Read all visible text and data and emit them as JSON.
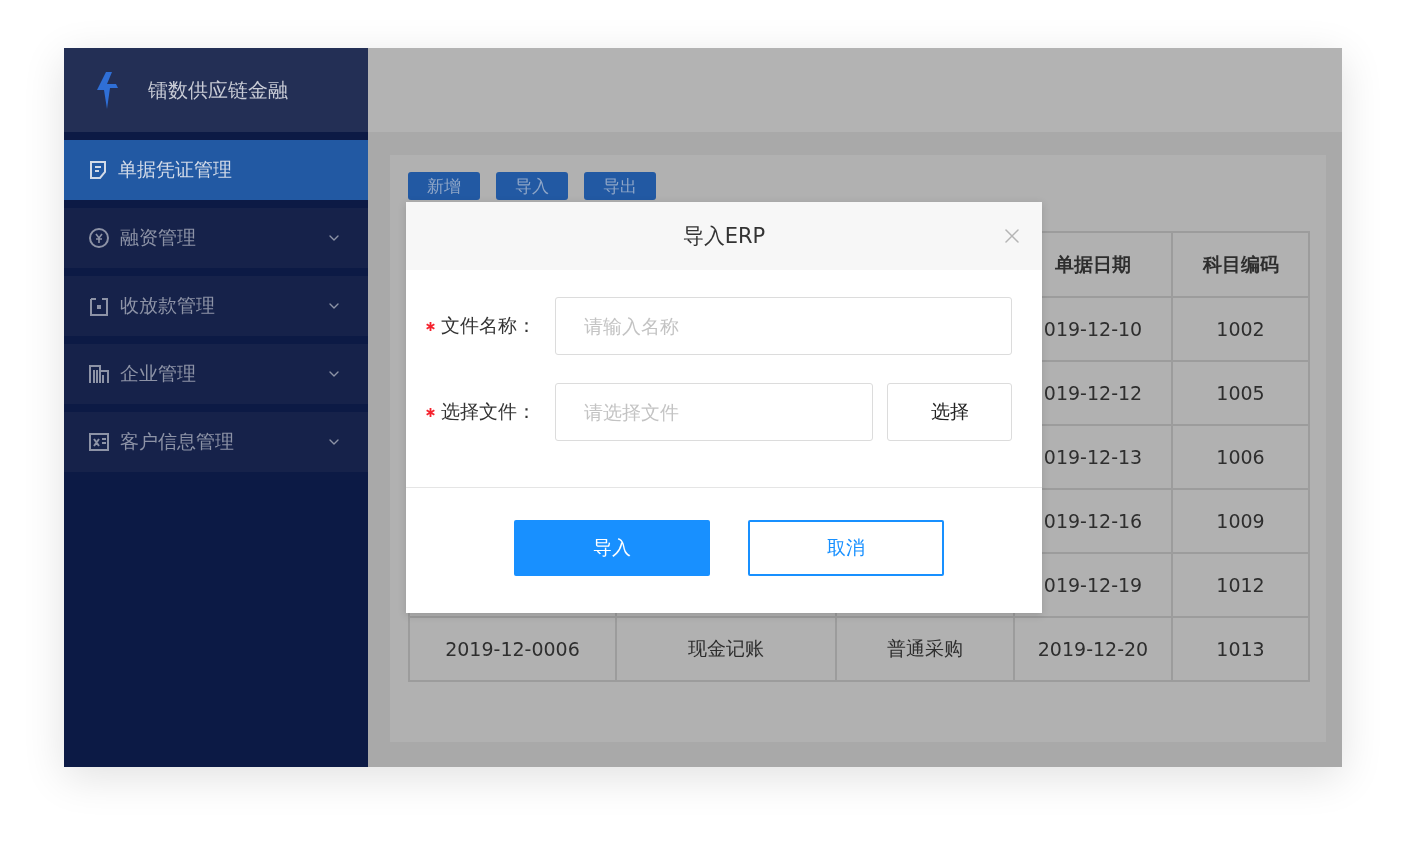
{
  "brand": {
    "name": "镭数供应链金融"
  },
  "sidebar": {
    "items": [
      {
        "label": "单据凭证管理",
        "selected": true,
        "has_children": false
      },
      {
        "label": "融资管理",
        "selected": false,
        "has_children": true
      },
      {
        "label": "收放款管理",
        "selected": false,
        "has_children": true
      },
      {
        "label": "企业管理",
        "selected": false,
        "has_children": true
      },
      {
        "label": "客户信息管理",
        "selected": false,
        "has_children": true
      }
    ]
  },
  "toolbar": {
    "buttons": [
      "新增",
      "导入",
      "导出"
    ]
  },
  "table": {
    "columns": [
      "单据日期",
      "科目编码"
    ],
    "rows": [
      {
        "cells": [
          "019-12-10",
          "1002"
        ]
      },
      {
        "cells": [
          "019-12-12",
          "1005"
        ]
      },
      {
        "cells": [
          "019-12-13",
          "1006"
        ]
      },
      {
        "cells": [
          "019-12-16",
          "1009"
        ]
      },
      {
        "cells": [
          "019-12-19",
          "1012"
        ]
      },
      {
        "cells": [
          "2019-12-0006",
          "现金记账",
          "普通采购",
          "2019-12-20",
          "1013"
        ]
      }
    ]
  },
  "dialog": {
    "title": "导入ERP",
    "fields": [
      {
        "kind": "text",
        "label": "文件名称：",
        "required": true,
        "placeholder": "请输入名称"
      },
      {
        "kind": "file",
        "label": "选择文件：",
        "required": true,
        "placeholder": "请选择文件",
        "button": "选择"
      }
    ],
    "buttons": [
      {
        "label": "导入",
        "kind": "primary"
      },
      {
        "label": "取消",
        "kind": "secondary"
      }
    ]
  }
}
